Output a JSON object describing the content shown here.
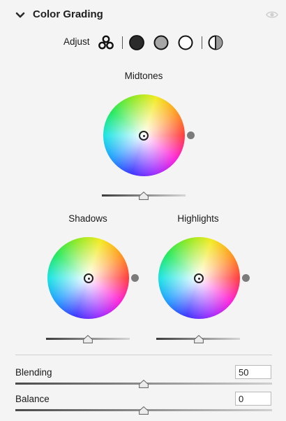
{
  "panel": {
    "title": "Color Grading"
  },
  "adjust": {
    "label": "Adjust",
    "modes": [
      "three-way",
      "shadows",
      "midtones",
      "highlights",
      "global"
    ]
  },
  "wheels": {
    "midtones": {
      "label": "Midtones",
      "luminance": 0.5
    },
    "shadows": {
      "label": "Shadows",
      "luminance": 0.5
    },
    "highlights": {
      "label": "Highlights",
      "luminance": 0.5
    }
  },
  "blending": {
    "label": "Blending",
    "value": "50",
    "fraction": 0.5
  },
  "balance": {
    "label": "Balance",
    "value": "0",
    "fraction": 0.5
  }
}
